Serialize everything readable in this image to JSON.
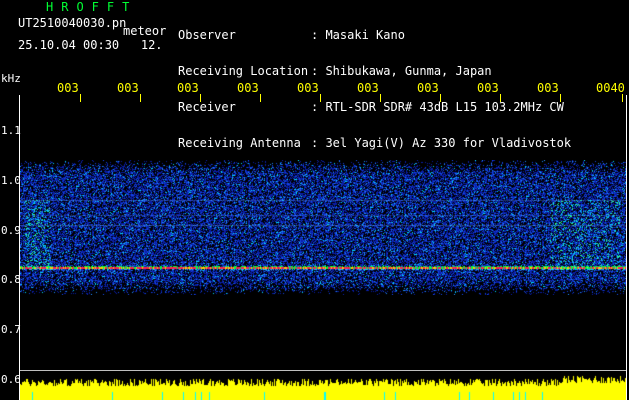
{
  "header": {
    "brand": "HROFFT",
    "file_name": "UT2510040030.pn",
    "event_label": "meteor",
    "date_time": "25.10.04 00:30",
    "count": "12.",
    "observer_label": "Observer",
    "observer_value": "Masaki Kano",
    "location_label": "Receiving Location",
    "location_value": "Shibukawa, Gunma, Japan",
    "receiver_label": "Receiver",
    "receiver_value": "RTL-SDR SDR# 43dB L15 103.2MHz CW",
    "antenna_label": "Receiving Antenna",
    "antenna_value": "3el Yagi(V) Az 330 for Vladivostok"
  },
  "axis": {
    "y_unit": "kHz",
    "y_ticks": [
      "1.1",
      "1.0",
      "0.9",
      "0.8",
      "0.7",
      "0.6"
    ],
    "time_labels": [
      "003",
      "003",
      "003",
      "003",
      "003",
      "003",
      "003",
      "003",
      "003",
      "0040"
    ]
  },
  "colors": {
    "background": "#000000",
    "noise_blue": "#0a2cd6",
    "noise_cyan": "#00d0ff",
    "signal_red": "#ff2050",
    "signal_green": "#00ff40",
    "power_yellow": "#ffff00"
  }
}
